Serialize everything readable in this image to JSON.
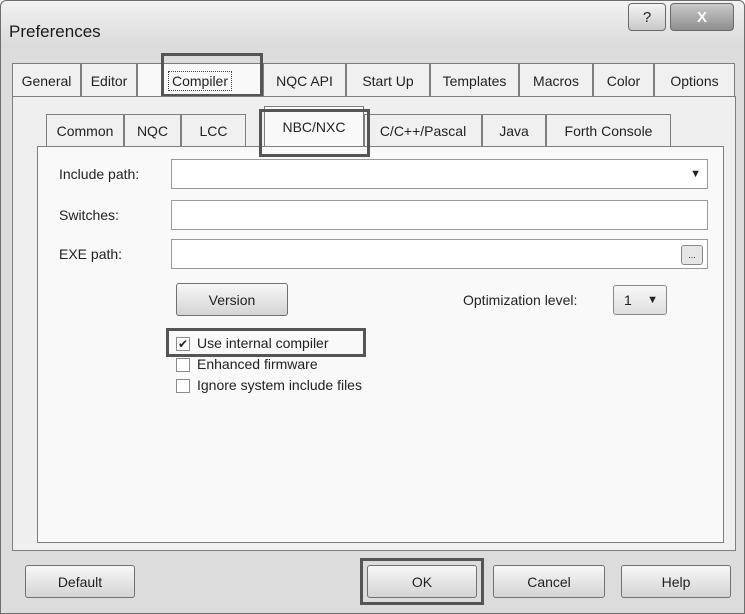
{
  "window": {
    "title": "Preferences",
    "help_glyph": "?",
    "close_glyph": "X"
  },
  "top_tabs": [
    {
      "label": "General"
    },
    {
      "label": "Editor"
    },
    {
      "label": "Compiler"
    },
    {
      "label": "NQC API"
    },
    {
      "label": "Start Up"
    },
    {
      "label": "Templates"
    },
    {
      "label": "Macros"
    },
    {
      "label": "Color"
    },
    {
      "label": "Options"
    }
  ],
  "sub_tabs": [
    {
      "label": "Common"
    },
    {
      "label": "NQC"
    },
    {
      "label": "LCC"
    },
    {
      "label": "NBC/NXC"
    },
    {
      "label": "C/C++/Pascal"
    },
    {
      "label": "Java"
    },
    {
      "label": "Forth Console"
    }
  ],
  "form": {
    "include_path_label": "Include path:",
    "include_path_value": "",
    "switches_label": "Switches:",
    "switches_value": "",
    "exe_path_label": "EXE path:",
    "exe_path_value": "",
    "browse_glyph": "...",
    "version_button": "Version",
    "optimization_label": "Optimization level:",
    "optimization_value": "1",
    "dropdown_glyph": "▼"
  },
  "checkboxes": [
    {
      "label": "Use internal compiler",
      "checked": true,
      "mark": "✔"
    },
    {
      "label": "Enhanced firmware",
      "checked": false,
      "mark": ""
    },
    {
      "label": "Ignore system include files",
      "checked": false,
      "mark": ""
    }
  ],
  "buttons": {
    "default": "Default",
    "ok": "OK",
    "cancel": "Cancel",
    "help": "Help"
  }
}
